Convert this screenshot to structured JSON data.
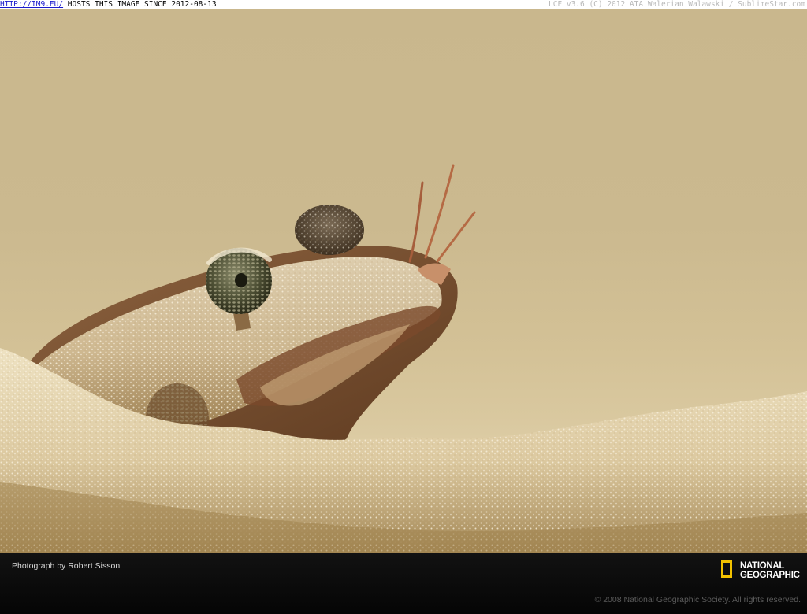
{
  "top_banner": {
    "link_text": "HTTP://IM9.EU/",
    "hosts_text": " HOSTS THIS IMAGE SINCE 2012-08-13",
    "right_text": "LCF v3.6 (C) 2012 ATA Walerian Walawski / SublimeStar.com"
  },
  "footer": {
    "photo_credit": "Photograph by Robert Sisson",
    "copyright": "© 2008 National Geographic Society. All rights reserved.",
    "logo": {
      "line1": "NATIONAL",
      "line2": "GEOGRAPHIC",
      "frame_color": "#f2c200"
    }
  },
  "colors": {
    "sand_light": "#e6d8b4",
    "sand_dark": "#a88e5c",
    "background": "#cbb98f",
    "footer_bar": "#0b0b0b"
  }
}
